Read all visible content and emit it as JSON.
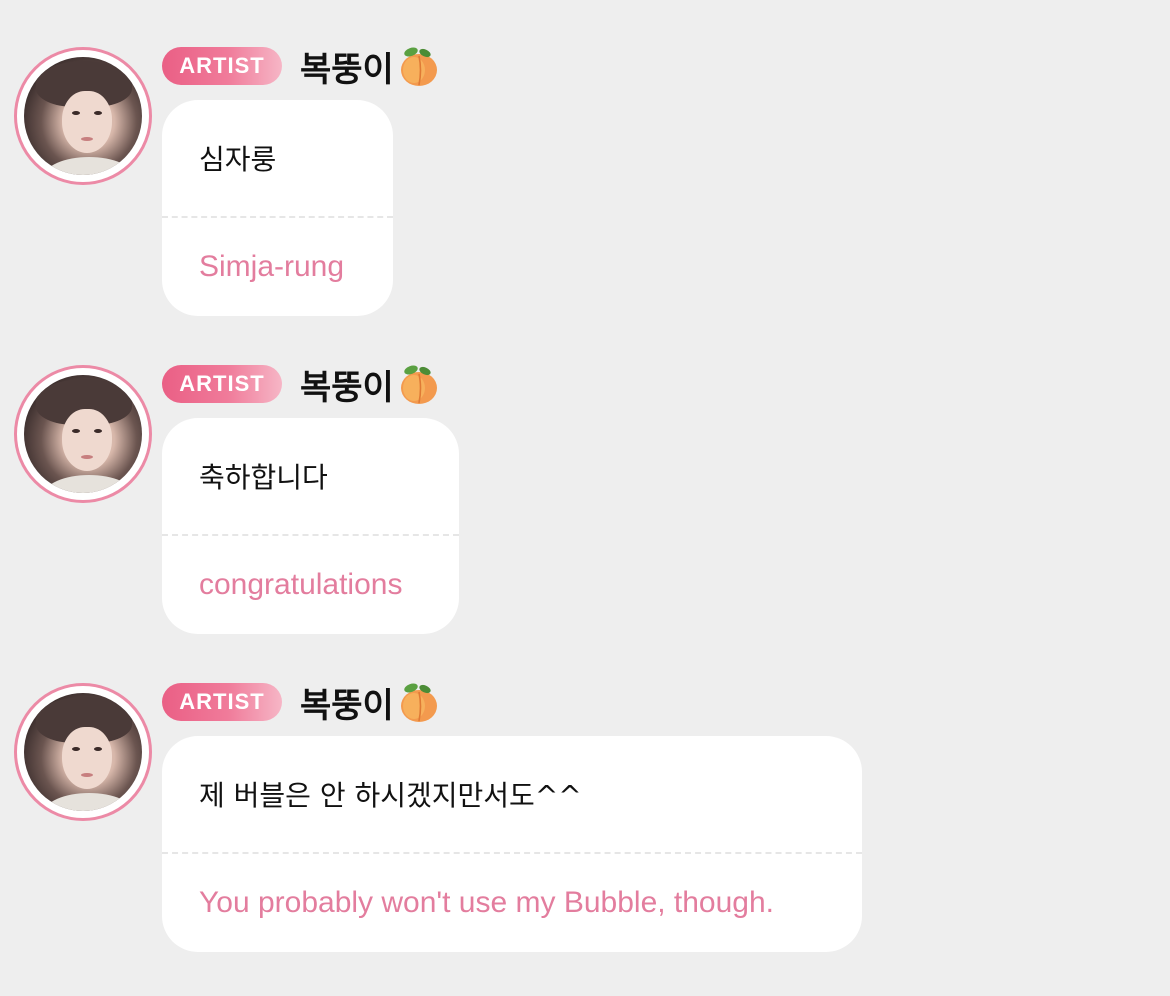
{
  "messages": [
    {
      "badge": "ARTIST",
      "sender": "복뚱이",
      "sender_emoji_icon": "peach-icon",
      "original": "심자룽",
      "translation": "Simja-rung"
    },
    {
      "badge": "ARTIST",
      "sender": "복뚱이",
      "sender_emoji_icon": "peach-icon",
      "original": "축하합니다",
      "translation": "congratulations"
    },
    {
      "badge": "ARTIST",
      "sender": "복뚱이",
      "sender_emoji_icon": "peach-icon",
      "original": "제 버블은 안 하시겠지만서도^^",
      "translation": "You probably won't use my Bubble, though."
    }
  ],
  "colors": {
    "background": "#eeeeee",
    "badge_gradient_start": "#ea5f85",
    "badge_gradient_end": "#f6b6c6",
    "translation_text": "#e37d9e",
    "avatar_ring": "#ec8aa6",
    "bubble": "#ffffff"
  }
}
